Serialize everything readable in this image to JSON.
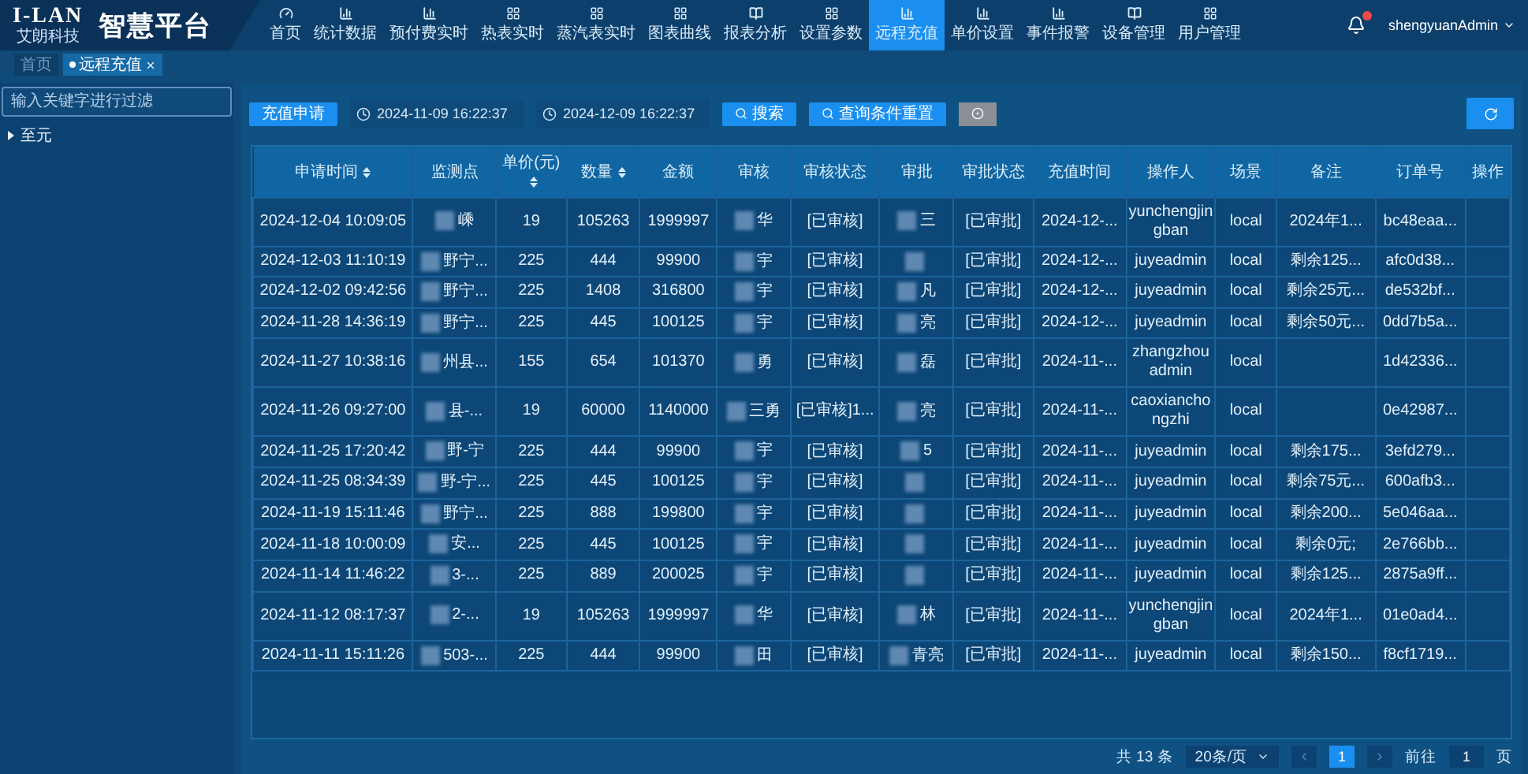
{
  "header": {
    "logo_mark": "I-LAN",
    "logo_sub": "艾朗科技",
    "title": "智慧平台"
  },
  "nav": [
    {
      "label": "首页",
      "kind": "gauge",
      "selected": false
    },
    {
      "label": "统计数据",
      "kind": "bars",
      "selected": false
    },
    {
      "label": "预付费实时",
      "kind": "bars",
      "selected": false
    },
    {
      "label": "热表实时",
      "kind": "grid",
      "selected": false
    },
    {
      "label": "蒸汽表实时",
      "kind": "grid",
      "selected": false
    },
    {
      "label": "图表曲线",
      "kind": "grid",
      "selected": false
    },
    {
      "label": "报表分析",
      "kind": "book",
      "selected": false
    },
    {
      "label": "设置参数",
      "kind": "grid",
      "selected": false
    },
    {
      "label": "远程充值",
      "kind": "bars",
      "selected": true
    },
    {
      "label": "单价设置",
      "kind": "bars",
      "selected": false
    },
    {
      "label": "事件报警",
      "kind": "bars",
      "selected": false
    },
    {
      "label": "设备管理",
      "kind": "book",
      "selected": false
    },
    {
      "label": "用户管理",
      "kind": "grid",
      "selected": false
    }
  ],
  "user": {
    "name": "shengyuanAdmin",
    "has_notification": true
  },
  "tabs": [
    {
      "label": "首页",
      "selected": false,
      "closable": false
    },
    {
      "label": "远程充值",
      "selected": true,
      "closable": true
    }
  ],
  "sidebar": {
    "filter_placeholder": "输入关键字进行过滤",
    "tree": [
      {
        "label": "至元",
        "expanded": false
      }
    ]
  },
  "toolbar": {
    "apply_button": "充值申请",
    "start_date": "2024-11-09 16:22:37",
    "end_date": "2024-12-09 16:22:37",
    "search_button": "搜索",
    "reset_button": "查询条件重置"
  },
  "table": {
    "columns": [
      {
        "label": "申请时间",
        "sortable": true,
        "redacted": false
      },
      {
        "label": "监测点",
        "sortable": false,
        "redacted": true
      },
      {
        "label": "单价(元)",
        "sortable": true,
        "redacted": false
      },
      {
        "label": "数量",
        "sortable": true,
        "redacted": false
      },
      {
        "label": "金额",
        "sortable": false,
        "redacted": false
      },
      {
        "label": "审核",
        "sortable": false,
        "redacted": true
      },
      {
        "label": "审核状态",
        "sortable": false,
        "redacted": false
      },
      {
        "label": "审批",
        "sortable": false,
        "redacted": true
      },
      {
        "label": "审批状态",
        "sortable": false,
        "redacted": false
      },
      {
        "label": "充值时间",
        "sortable": false,
        "redacted": false
      },
      {
        "label": "操作人",
        "sortable": false,
        "redacted": false
      },
      {
        "label": "场景",
        "sortable": false,
        "redacted": false
      },
      {
        "label": "备注",
        "sortable": false,
        "redacted": false
      },
      {
        "label": "订单号",
        "sortable": false,
        "redacted": false
      },
      {
        "label": "操作",
        "sortable": false,
        "redacted": false
      }
    ],
    "rows": [
      [
        "2024-12-04 10:09:05",
        "嵊",
        "19",
        "105263",
        "1999997",
        "华",
        "[已审核]",
        "三",
        "[已审批]",
        "2024-12-...",
        "yunchengjingban",
        "local",
        "2024年1...",
        "bc48eaa...",
        ""
      ],
      [
        "2024-12-03 11:10:19",
        "野宁...",
        "225",
        "444",
        "99900",
        "宇",
        "[已审核]",
        "",
        "[已审批]",
        "2024-12-...",
        "juyeadmin",
        "local",
        "剩余125...",
        "afc0d38...",
        ""
      ],
      [
        "2024-12-02 09:42:56",
        "野宁...",
        "225",
        "1408",
        "316800",
        "宇",
        "[已审核]",
        "凡",
        "[已审批]",
        "2024-12-...",
        "juyeadmin",
        "local",
        "剩余25元...",
        "de532bf...",
        ""
      ],
      [
        "2024-11-28 14:36:19",
        "野宁...",
        "225",
        "445",
        "100125",
        "宇",
        "[已审核]",
        "亮",
        "[已审批]",
        "2024-12-...",
        "juyeadmin",
        "local",
        "剩余50元...",
        "0dd7b5a...",
        ""
      ],
      [
        "2024-11-27 10:38:16",
        "州县...",
        "155",
        "654",
        "101370",
        "勇",
        "[已审核]",
        "磊",
        "[已审批]",
        "2024-11-...",
        "zhangzhouadmin",
        "local",
        "",
        "1d42336...",
        ""
      ],
      [
        "2024-11-26 09:27:00",
        "县-...",
        "19",
        "60000",
        "1140000",
        "三勇",
        "[已审核]1...",
        "亮",
        "[已审批]",
        "2024-11-...",
        "caoxianchongzhi",
        "local",
        "",
        "0e42987...",
        ""
      ],
      [
        "2024-11-25 17:20:42",
        "野-宁",
        "225",
        "444",
        "99900",
        "宇",
        "[已审核]",
        "5",
        "[已审批]",
        "2024-11-...",
        "juyeadmin",
        "local",
        "剩余175...",
        "3efd279...",
        ""
      ],
      [
        "2024-11-25 08:34:39",
        "野-宁...",
        "225",
        "445",
        "100125",
        "宇",
        "[已审核]",
        "",
        "[已审批]",
        "2024-11-...",
        "juyeadmin",
        "local",
        "剩余75元...",
        "600afb3...",
        ""
      ],
      [
        "2024-11-19 15:11:46",
        "野宁...",
        "225",
        "888",
        "199800",
        "宇",
        "[已审核]",
        "",
        "[已审批]",
        "2024-11-...",
        "juyeadmin",
        "local",
        "剩余200...",
        "5e046aa...",
        ""
      ],
      [
        "2024-11-18 10:00:09",
        "安...",
        "225",
        "445",
        "100125",
        "宇",
        "[已审核]",
        "",
        "[已审批]",
        "2024-11-...",
        "juyeadmin",
        "local",
        "剩余0元;",
        "2e766bb...",
        ""
      ],
      [
        "2024-11-14 11:46:22",
        "3-...",
        "225",
        "889",
        "200025",
        "宇",
        "[已审核]",
        "",
        "[已审批]",
        "2024-11-...",
        "juyeadmin",
        "local",
        "剩余125...",
        "2875a9ff...",
        ""
      ],
      [
        "2024-11-12 08:17:37",
        "2-...",
        "19",
        "105263",
        "1999997",
        "华",
        "[已审核]",
        "林",
        "[已审批]",
        "2024-11-...",
        "yunchengjingban",
        "local",
        "2024年1...",
        "01e0ad4...",
        ""
      ],
      [
        "2024-11-11 15:11:26",
        "503-...",
        "225",
        "444",
        "99900",
        "田",
        "[已审核]",
        "青亮",
        "[已审批]",
        "2024-11-...",
        "juyeadmin",
        "local",
        "剩余150...",
        "f8cf1719...",
        ""
      ]
    ]
  },
  "pagination": {
    "total": "共 13 条",
    "page_size": "20条/页",
    "pages": [
      {
        "label": "1",
        "selected": true
      }
    ],
    "goto_label": "前往",
    "goto_value": "1",
    "page_suffix": "页"
  }
}
